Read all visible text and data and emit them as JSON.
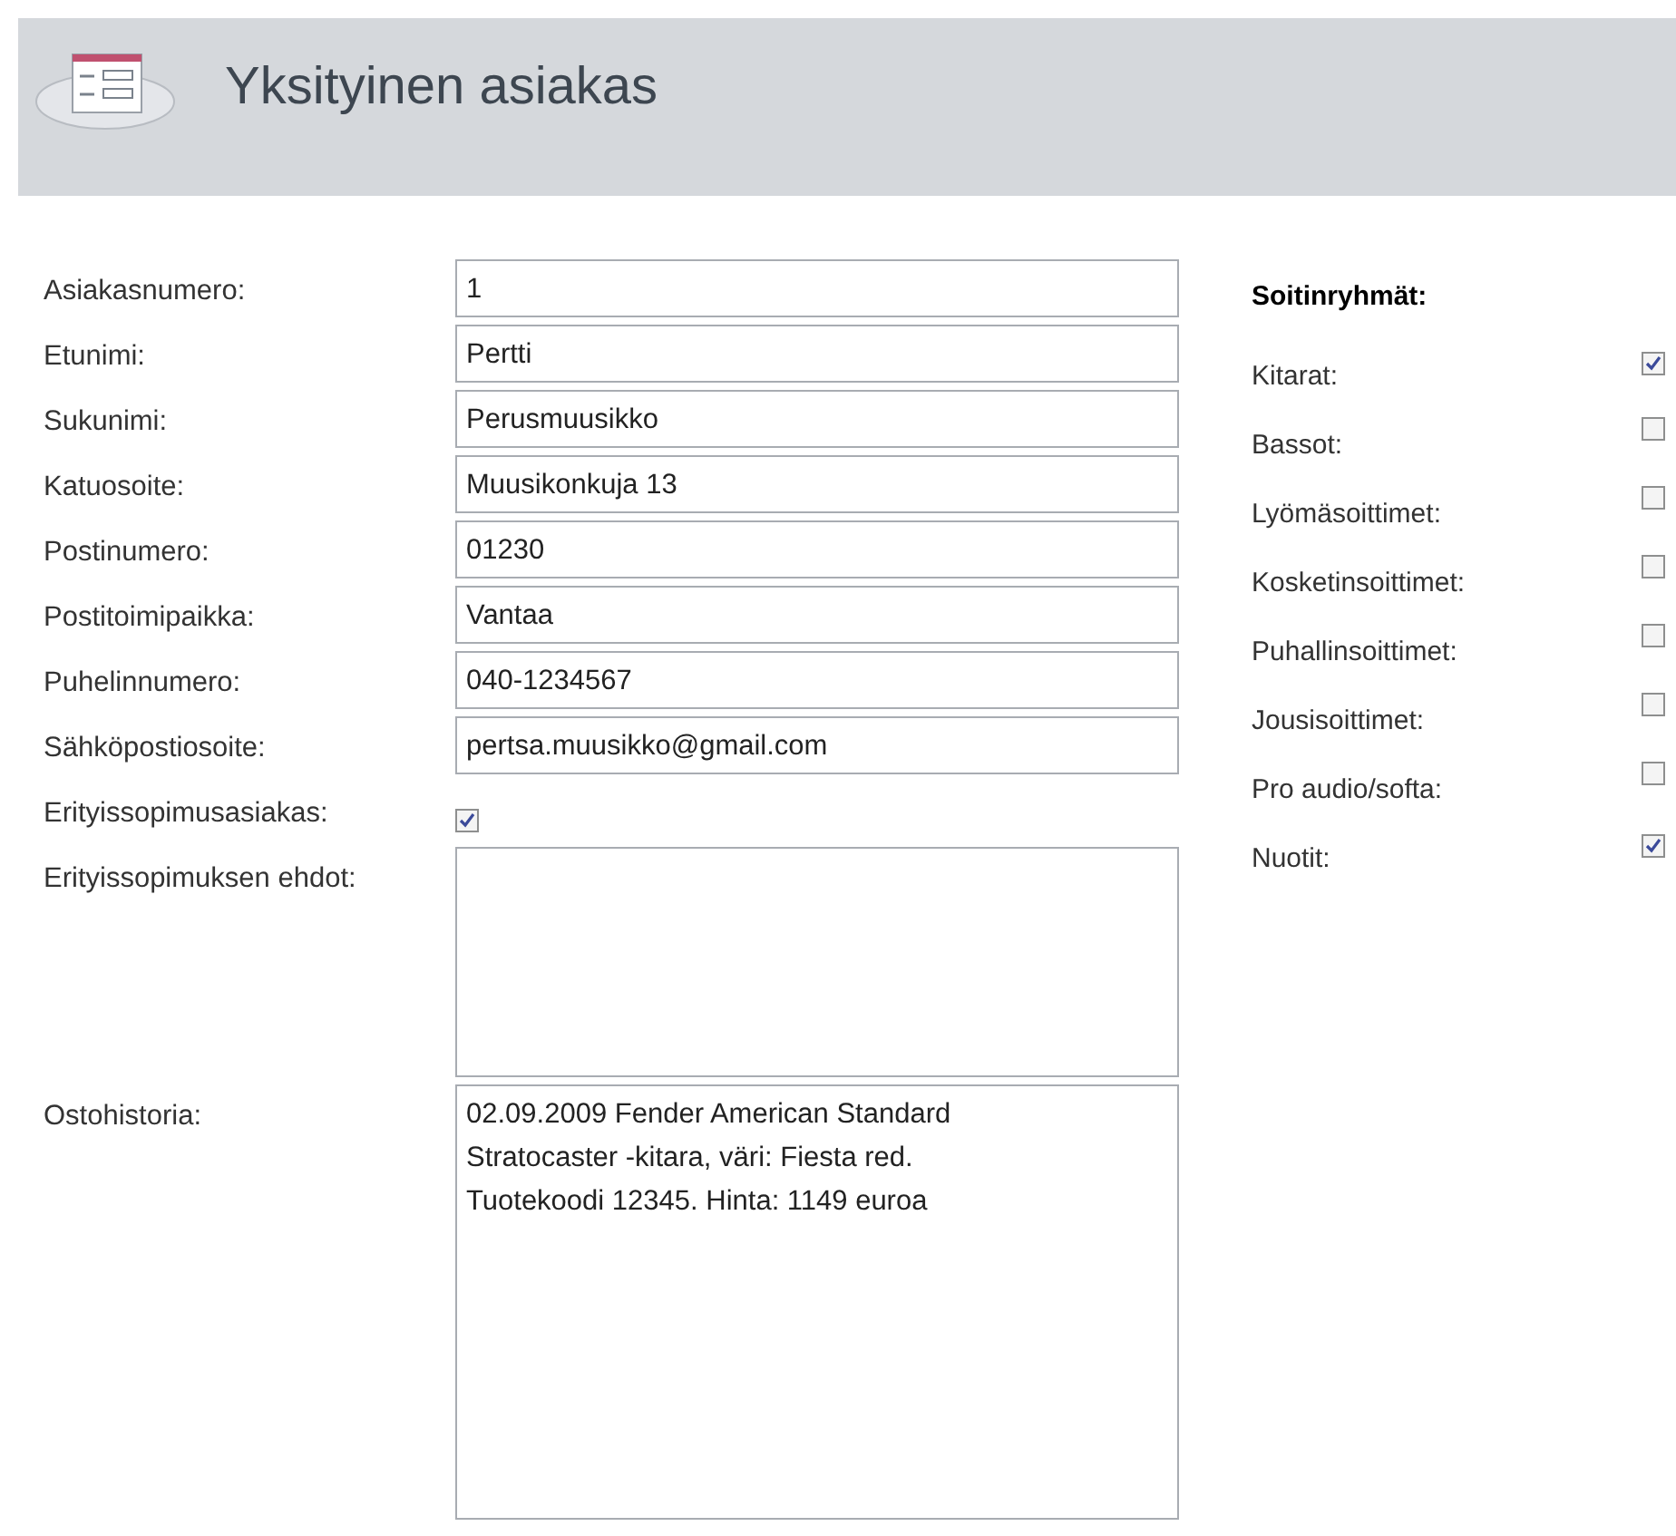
{
  "header": {
    "title": "Yksityinen asiakas"
  },
  "fields": [
    {
      "kind": "text",
      "label": "Asiakasnumero:",
      "value": "1"
    },
    {
      "kind": "text",
      "label": "Etunimi:",
      "value": "Pertti"
    },
    {
      "kind": "text",
      "label": "Sukunimi:",
      "value": "Perusmuusikko"
    },
    {
      "kind": "text",
      "label": "Katuosoite:",
      "value": "Muusikonkuja 13"
    },
    {
      "kind": "text",
      "label": "Postinumero:",
      "value": "01230"
    },
    {
      "kind": "text",
      "label": "Postitoimipaikka:",
      "value": "Vantaa"
    },
    {
      "kind": "text",
      "label": "Puhelinnumero:",
      "value": "040-1234567"
    },
    {
      "kind": "text",
      "label": "Sähköpostiosoite:",
      "value": "pertsa.muusikko@gmail.com"
    },
    {
      "kind": "checkbox",
      "label": "Erityissopimusasiakas:",
      "checked": true
    },
    {
      "kind": "memo",
      "label": "Erityissopimuksen ehdot:"
    },
    {
      "kind": "history",
      "label": "Ostohistoria:",
      "value": "02.09.2009 Fender American Standard Stratocaster -kitara, väri: Fiesta red. Tuotekoodi 12345. Hinta: 1149 euroa"
    }
  ],
  "groups": {
    "title": "Soitinryhmät:",
    "items": [
      {
        "label": "Kitarat:",
        "checked": true
      },
      {
        "label": "Bassot:",
        "checked": false
      },
      {
        "label": "Lyömäsoittimet:",
        "checked": false
      },
      {
        "label": "Kosketinsoittimet:",
        "checked": false
      },
      {
        "label": "Puhallinsoittimet:",
        "checked": false
      },
      {
        "label": "Jousisoittimet:",
        "checked": false
      },
      {
        "label": "Pro audio/softa:",
        "checked": false
      },
      {
        "label": "Nuotit:",
        "checked": true
      }
    ]
  }
}
